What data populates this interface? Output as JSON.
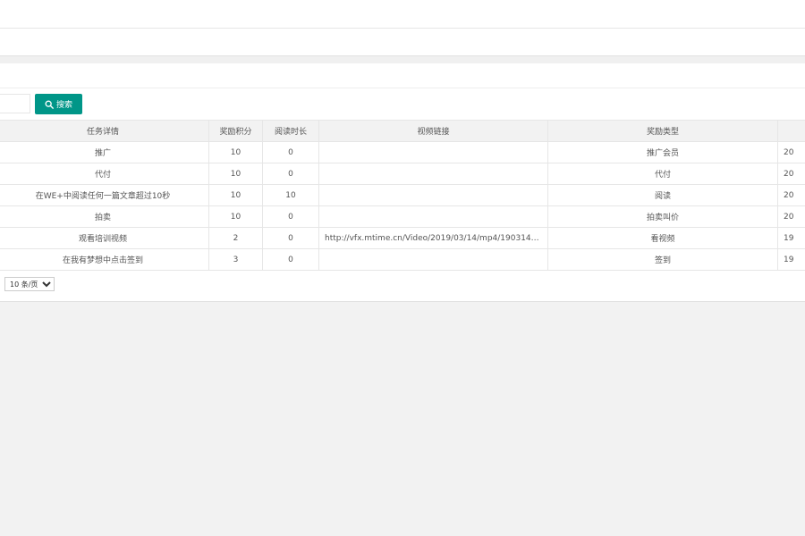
{
  "search": {
    "input_value": "",
    "button_label": "搜索",
    "icon": "search-icon"
  },
  "table": {
    "headers": [
      "任务详情",
      "奖励积分",
      "阅读时长",
      "视频链接",
      "奖励类型",
      ""
    ],
    "rows": [
      {
        "detail": "推广",
        "points": "10",
        "duration": "0",
        "link": "",
        "type": "推广会员",
        "extra": "20"
      },
      {
        "detail": "代付",
        "points": "10",
        "duration": "0",
        "link": "",
        "type": "代付",
        "extra": "20"
      },
      {
        "detail": "在WE+中阅读任何一篇文章超过10秒",
        "points": "10",
        "duration": "10",
        "link": "",
        "type": "阅读",
        "extra": "20"
      },
      {
        "detail": "拍卖",
        "points": "10",
        "duration": "0",
        "link": "",
        "type": "拍卖叫价",
        "extra": "20"
      },
      {
        "detail": "观看培训视频",
        "points": "2",
        "duration": "0",
        "link": "http://vfx.mtime.cn/Video/2019/03/14/mp4/1903142235403...",
        "type": "看视频",
        "extra": "19"
      },
      {
        "detail": "在我有梦想中点击签到",
        "points": "3",
        "duration": "0",
        "link": "",
        "type": "签到",
        "extra": "19"
      }
    ]
  },
  "pager": {
    "page_size_label": "10 条/页"
  },
  "colors": {
    "accent": "#009688",
    "page_bg": "#f2f2f2",
    "header_bg": "#f2f2f2",
    "border": "#e6e6e6"
  }
}
